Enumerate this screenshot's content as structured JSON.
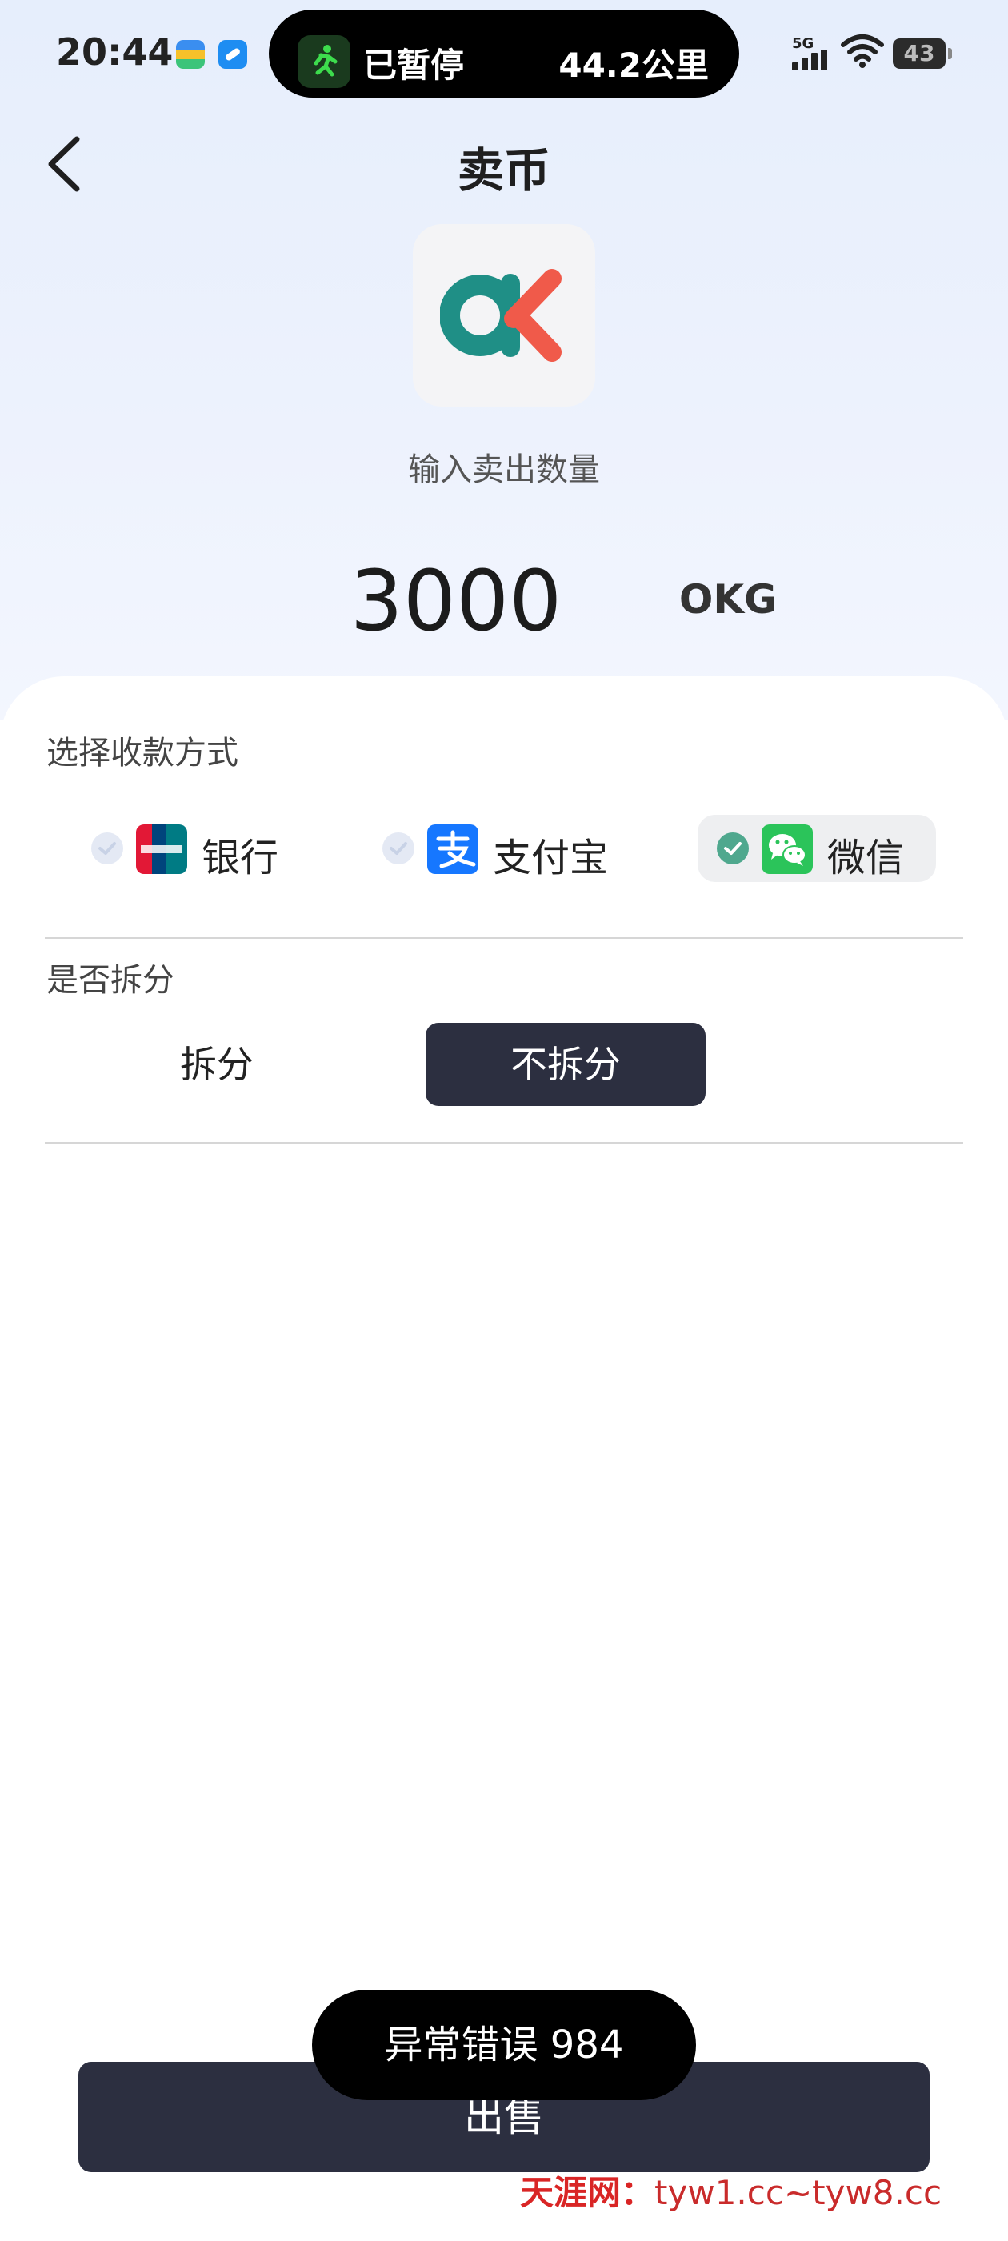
{
  "status_bar": {
    "time": "20:44",
    "island_paused": "已暂停",
    "island_distance": "44.2公里",
    "network": "5G",
    "battery": "43"
  },
  "header": {
    "title": "卖币"
  },
  "coin": {
    "prompt": "输入卖出数量",
    "amount": "3000",
    "unit": "OKG"
  },
  "payment": {
    "label": "选择收款方式",
    "options": [
      {
        "name": "银行",
        "selected": false
      },
      {
        "name": "支付宝",
        "selected": false
      },
      {
        "name": "微信",
        "selected": true
      }
    ]
  },
  "split": {
    "label": "是否拆分",
    "options": [
      {
        "name": "拆分",
        "selected": false
      },
      {
        "name": "不拆分",
        "selected": true
      }
    ]
  },
  "sell_button": "出售",
  "toast": "异常错误 984",
  "watermark": {
    "brand": "天涯网：",
    "urls": "tyw1.cc~tyw8.cc"
  },
  "colors": {
    "primary_dark": "#2c2f40",
    "check_green": "#4fa88e",
    "wechat_green": "#2bc45a",
    "alipay_blue": "#1677ff",
    "watermark_red": "#d92525"
  }
}
